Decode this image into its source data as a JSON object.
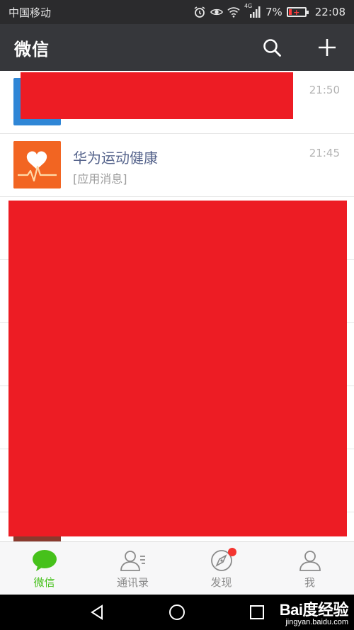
{
  "status_bar": {
    "carrier": "中国移动",
    "network_badge": "4G",
    "battery_percent": "7%",
    "time": "22:08"
  },
  "header": {
    "title": "微信",
    "icons": [
      "search-icon",
      "plus-icon"
    ]
  },
  "chats": [
    {
      "name": "",
      "preview": "",
      "time": "21:50",
      "redacted": true
    },
    {
      "name": "华为运动健康",
      "preview": "[应用消息]",
      "time": "21:45",
      "redacted": false
    },
    {
      "name": "",
      "preview": "",
      "time": "",
      "redacted": true
    },
    {
      "name": "",
      "preview": "",
      "time": "",
      "redacted": true
    },
    {
      "name": "",
      "preview": "",
      "time": "",
      "redacted": true
    },
    {
      "name": "",
      "preview": "",
      "time": "",
      "redacted": true
    },
    {
      "name": "",
      "preview": "",
      "time": "",
      "redacted": true
    },
    {
      "name": "",
      "preview": "",
      "time": "",
      "redacted": true
    }
  ],
  "tabs": [
    {
      "label": "微信",
      "icon": "chat-bubble-icon",
      "active": true
    },
    {
      "label": "通讯录",
      "icon": "contacts-icon",
      "active": false
    },
    {
      "label": "发现",
      "icon": "compass-icon",
      "active": false,
      "badge": true
    },
    {
      "label": "我",
      "icon": "person-icon",
      "active": false
    }
  ],
  "colors": {
    "header_bg": "#36373b",
    "status_bg": "#2b2b2d",
    "active_tab": "#46c11b",
    "inactive_tab": "#8a8a8a",
    "badge_red": "#f43530",
    "redaction": "#ed1c24",
    "chat_name": "#56648c"
  },
  "watermark": {
    "brand": "Bai度经验",
    "url": "jingyan.baidu.com"
  }
}
